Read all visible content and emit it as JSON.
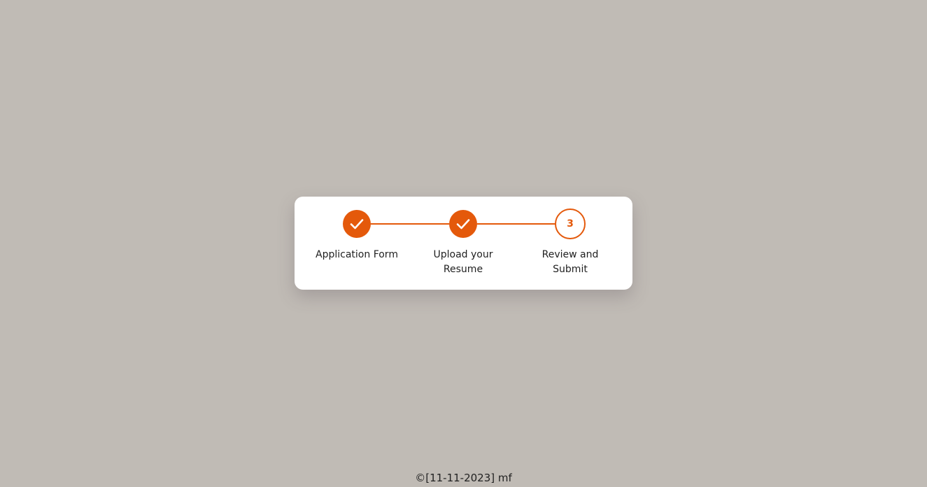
{
  "colors": {
    "background": "#c0bbb5",
    "card": "#ffffff",
    "accent": "#e4590b",
    "text": "#1f1f1f"
  },
  "stepper": {
    "steps": [
      {
        "label": "Application Form",
        "status": "completed",
        "icon": "check-icon"
      },
      {
        "label": "Upload your Resume",
        "status": "completed",
        "icon": "check-icon"
      },
      {
        "label": "Review and Submit",
        "status": "current",
        "number": "3"
      }
    ]
  },
  "footer": {
    "text": "©[11-11-2023] mf"
  }
}
